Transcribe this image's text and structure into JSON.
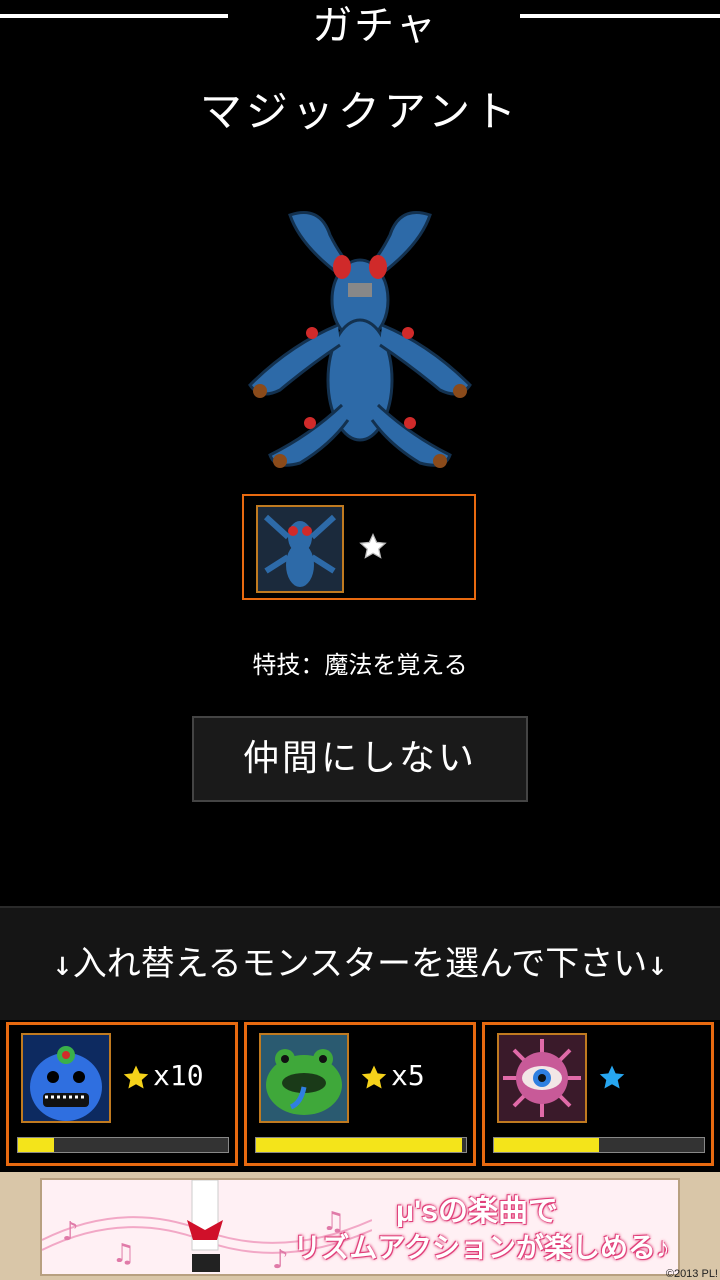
{
  "header": {
    "title": "ガチャ"
  },
  "monster": {
    "name": "マジックアント"
  },
  "card": {
    "stars": 1
  },
  "skill": {
    "text": "特技：魔法を覚える"
  },
  "decline_button": {
    "label": "仲間にしない"
  },
  "banner": {
    "text": "↓入れ替えるモンスターを選んで下さい↓"
  },
  "slots": [
    {
      "count": "x10",
      "star_color": "#f5d21a",
      "hp": 0.17
    },
    {
      "count": "x5",
      "star_color": "#f5d21a",
      "hp": 0.98
    },
    {
      "count": "",
      "star_color": "#27a6f0",
      "hp": 0.5
    }
  ],
  "ad": {
    "line1": "μ'sの楽曲で",
    "line2": "リズムアクションが楽しめる♪",
    "copyright": "©2013 PL!"
  },
  "colors": {
    "accent": "#e86a10",
    "bar_fill": "#f4e41a"
  }
}
